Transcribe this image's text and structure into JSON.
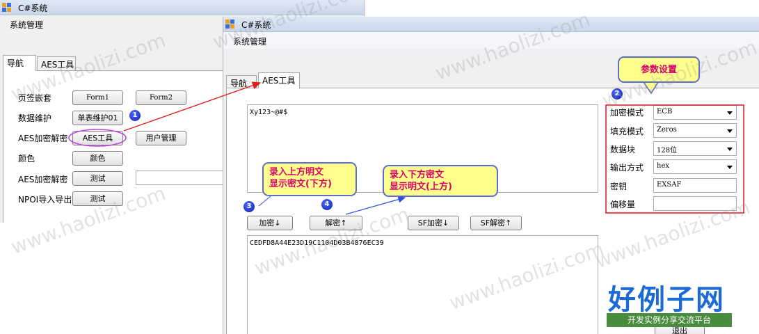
{
  "back_window": {
    "title": "C#系统",
    "menu": "系统管理",
    "tabs": [
      "导航",
      "AES工具"
    ],
    "rows": [
      {
        "label": "页签嵌套",
        "buttons": [
          "Form1",
          "Form2"
        ]
      },
      {
        "label": "数据维护",
        "buttons": [
          "单表维护01"
        ]
      },
      {
        "label": "AES加密解密",
        "buttons": [
          "AES工具",
          "用户管理"
        ]
      },
      {
        "label": "颜色",
        "buttons": [
          "颜色"
        ]
      },
      {
        "label": "AES加密解密",
        "buttons": [
          "测试"
        ]
      },
      {
        "label": "NPOI导入导出",
        "buttons": [
          "测试"
        ]
      }
    ]
  },
  "front_window": {
    "title": "C#系统",
    "menu": "系统管理",
    "tabs": [
      "导航",
      "AES工具"
    ],
    "plaintext": "Xy123~@#$",
    "ciphertext": "CEDFD8A44E23D19C1104D03B4876EC39",
    "buttons": {
      "encrypt": "加密↓",
      "decrypt": "解密↑",
      "sf_encrypt": "SF加密↓",
      "sf_decrypt": "SF解密↑",
      "exit": "退出"
    },
    "settings": [
      {
        "label": "加密模式",
        "value": "ECB",
        "type": "select"
      },
      {
        "label": "填充模式",
        "value": "Zeros",
        "type": "select"
      },
      {
        "label": "数据块",
        "value": "128位",
        "type": "select"
      },
      {
        "label": "输出方式",
        "value": "hex",
        "type": "select"
      },
      {
        "label": "密钥",
        "value": "EXSAF",
        "type": "text"
      },
      {
        "label": "偏移量",
        "value": "",
        "type": "text"
      }
    ]
  },
  "annotations": {
    "callout_params": "参数设置",
    "callout_encrypt": [
      "录入上方明文",
      "显示密文(下方)"
    ],
    "callout_decrypt": [
      "录入下方密文",
      "显示明文(上方)"
    ],
    "numbers": [
      "1",
      "2",
      "3",
      "4"
    ]
  },
  "watermark": {
    "text": "www.haolizi.com",
    "logo": "好例子网",
    "slogan": "开发实例分享交流平台"
  },
  "colors": {
    "arrow_red": "#e02020",
    "highlight_box": "#e0202a",
    "ellipse": "#c040e0",
    "callout_fill": "#ffff8c",
    "callout_text": "#d9006c",
    "badge_blue": "#0a1fb0",
    "logo_blue": "#1b6ad6",
    "logo_green": "#4a8c3e"
  }
}
